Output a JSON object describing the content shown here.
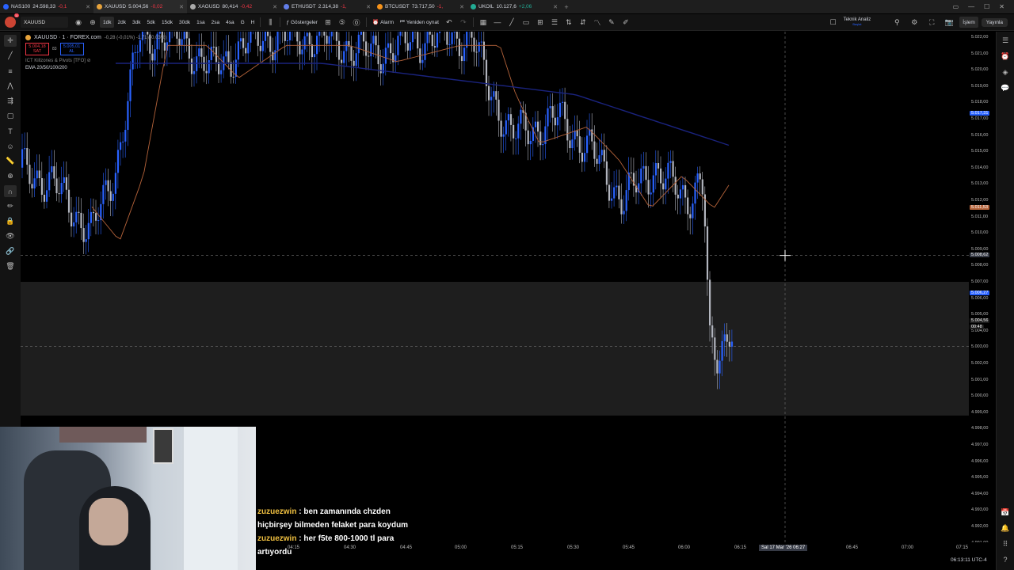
{
  "tabs": [
    {
      "symbol": "NAS100",
      "price": "24.598,33",
      "change": "-0,1",
      "dir": "neg",
      "color": "#2962ff"
    },
    {
      "symbol": "XAUUSD",
      "price": "5.004,56",
      "change": "-0,02",
      "dir": "neg",
      "color": "#e7a33b",
      "active": true
    },
    {
      "symbol": "XAGUSD",
      "price": "80,414",
      "change": "-0,42",
      "dir": "neg",
      "color": "#aaaaaa"
    },
    {
      "symbol": "ETHUSDT",
      "price": "2.314,38",
      "change": "-1,",
      "dir": "neg",
      "color": "#627eea"
    },
    {
      "symbol": "BTCUSDT",
      "price": "73.717,50",
      "change": "-1,",
      "dir": "neg",
      "color": "#f7931a"
    },
    {
      "symbol": "UKOIL",
      "price": "10.127,6",
      "change": "+2,06",
      "dir": "pos",
      "color": "#22ab94"
    }
  ],
  "toolbar": {
    "symbol": "XAUUSD",
    "intervals": [
      "1dk",
      "2dk",
      "3dk",
      "5dk",
      "15dk",
      "30dk",
      "1sa",
      "2sa",
      "4sa",
      "G",
      "H"
    ],
    "selected_interval": "1dk",
    "indicators_label": "Göstergeler",
    "alert_label": "Alarm",
    "replay_label": "Yeniden oynat",
    "tech_analysis_label": "Teknik Analiz",
    "tech_analysis_sub": "Başlat",
    "trade_label": "İşlem",
    "publish_label": "Yayınla"
  },
  "legend": {
    "title": "XAUUSD · 1 · FOREX.com",
    "change": "-0,28 (-0,01%) -1,71 (-0,03%)",
    "sell_price": "5.004,18",
    "sell_label": "SAT",
    "buy_price": "5.005,01",
    "buy_label": "AL",
    "spread": "83",
    "indicator1": "ICT Killzones & Pivots [TFO]",
    "indicator2": "EMA 20/50/100/200"
  },
  "price_axis": {
    "ticks": [
      "5.022,00",
      "5.021,00",
      "5.020,00",
      "5.019,00",
      "5.018,00",
      "5.017,00",
      "5.016,00",
      "5.015,00",
      "5.014,00",
      "5.013,00",
      "5.012,00",
      "5.011,00",
      "5.010,00",
      "5.009,00",
      "5.008,00",
      "5.007,00",
      "5.006,00",
      "5.005,00",
      "5.004,00",
      "5.003,00",
      "5.002,00",
      "5.001,00",
      "5.000,00",
      "4.999,00",
      "4.998,00",
      "4.997,00",
      "4.996,00",
      "4.995,00",
      "4.994,00",
      "4.993,00",
      "4.992,00",
      "4.991,00"
    ],
    "label_ema_blue": "5.017,31",
    "label_ema_orange": "5.011,53",
    "label_crosshair": "5.008,62",
    "label_level": "5.006,27",
    "label_price": "5.004,56",
    "label_countdown": "00:48"
  },
  "time_axis": {
    "ticks": [
      "04:15",
      "04:30",
      "04:45",
      "05:00",
      "05:15",
      "05:30",
      "05:45",
      "06:00",
      "06:15",
      "06:45",
      "07:00",
      "07:15"
    ],
    "crosshair": "Sal 17 Mar '26   06:27"
  },
  "status": {
    "clock": "06:13:11 UTC-4"
  },
  "chat": [
    {
      "user": "zuzuezwin",
      "text": ": ben zamanında chzden hiçbirşey bilmeden felaket para koydum"
    },
    {
      "user": "zuzuezwin",
      "text": ": her f5te 800-1000 tl para artıyordu"
    }
  ],
  "colors": {
    "bull": "#2962ff",
    "bear": "#b2b5be",
    "ema_orange": "#b5633a",
    "ema_blue": "#1a237e",
    "zone": "#1e1e1e"
  }
}
